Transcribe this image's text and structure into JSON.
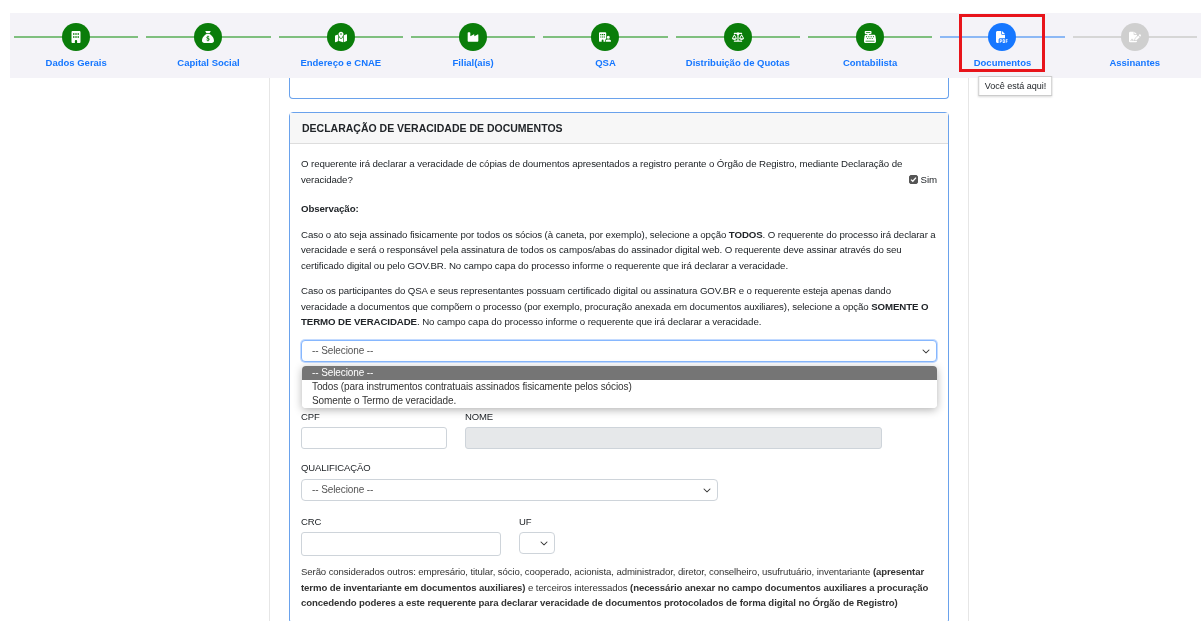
{
  "steps": [
    {
      "label": "Dados Gerais",
      "completed": true,
      "selected": false,
      "highlighted": false
    },
    {
      "label": "Capital Social",
      "completed": true,
      "selected": false,
      "highlighted": false
    },
    {
      "label": "Endereço e CNAE",
      "completed": true,
      "selected": false,
      "highlighted": false
    },
    {
      "label": "Filial(ais)",
      "completed": true,
      "selected": false,
      "highlighted": false
    },
    {
      "label": "QSA",
      "completed": true,
      "selected": false,
      "highlighted": false
    },
    {
      "label": "Distribuição de Quotas",
      "completed": true,
      "selected": false,
      "highlighted": false
    },
    {
      "label": "Contabilista",
      "completed": true,
      "selected": false,
      "highlighted": false
    },
    {
      "label": "Documentos",
      "completed": false,
      "selected": true,
      "highlighted": true
    },
    {
      "label": "Assinantes",
      "completed": false,
      "selected": false,
      "highlighted": false
    }
  ],
  "tooltip": "Você está aqui!",
  "section": {
    "title": "DECLARAÇÃO DE VERACIDADE DE DOCUMENTOS",
    "question": "O requerente irá declarar a veracidade de cópias de doumentos apresentados a registro perante o Órgão de Registro, mediante Declaração de veracidade?",
    "confirm": {
      "label": "Sim",
      "checked": true
    },
    "observation_title": "Observação:",
    "paragraphs": [
      "Caso o ato seja assinado fisicamente por todos os sócios (à caneta, por exemplo), selecione a opção **TODOS**. O requerente do processo irá declarar a veracidade e será o responsável pela assinatura de todos os campos/abas do assinador digital web. O requerente deve assinar através do seu certificado digital ou pelo GOV.BR. No campo capa do processo informe o requerente que irá declarar a veracidade.",
      "Caso os participantes do QSA e seus representantes possuam certificado digital ou assinatura GOV.BR e o requerente esteja apenas dando veracidade a documentos que compõem o processo (por exemplo, procuração anexada em documentos auxiliares), selecione a opção **SOMENTE O TERMO DE VERACIDADE**. No campo capa do processo informe o requerente que irá declarar a veracidade."
    ],
    "select": {
      "value": "-- Selecione --",
      "open": true,
      "options": [
        {
          "label": "-- Selecione --",
          "selected": true
        },
        {
          "label": "Todos (para instrumentos contratuais assinados fisicamente pelos sócios)",
          "selected": false
        },
        {
          "label": "Somente o Termo de veracidade.",
          "selected": false
        }
      ]
    },
    "cpf": {
      "label": "CPF",
      "disabled": false
    },
    "nome": {
      "label": "NOME",
      "disabled": true
    },
    "qualificacao": {
      "label": "QUALIFICAÇÃO",
      "value": "-- Selecione --"
    },
    "crc": {
      "label": "CRC"
    },
    "uf": {
      "label": "UF"
    },
    "note": "Serão considerados outros: empresário, titular, sócio, cooperado, acionista, administrador, diretor, conselheiro, usufrutuário, inventariante **(apresentar termo de inventariante em documentos auxiliares)** e terceiros interessados **(necessário anexar no campo documentos auxiliares a procuração concedendo poderes a este requerente para declarar veracidade de documentos protocolados de forma digital no Órgão de Registro)**"
  }
}
